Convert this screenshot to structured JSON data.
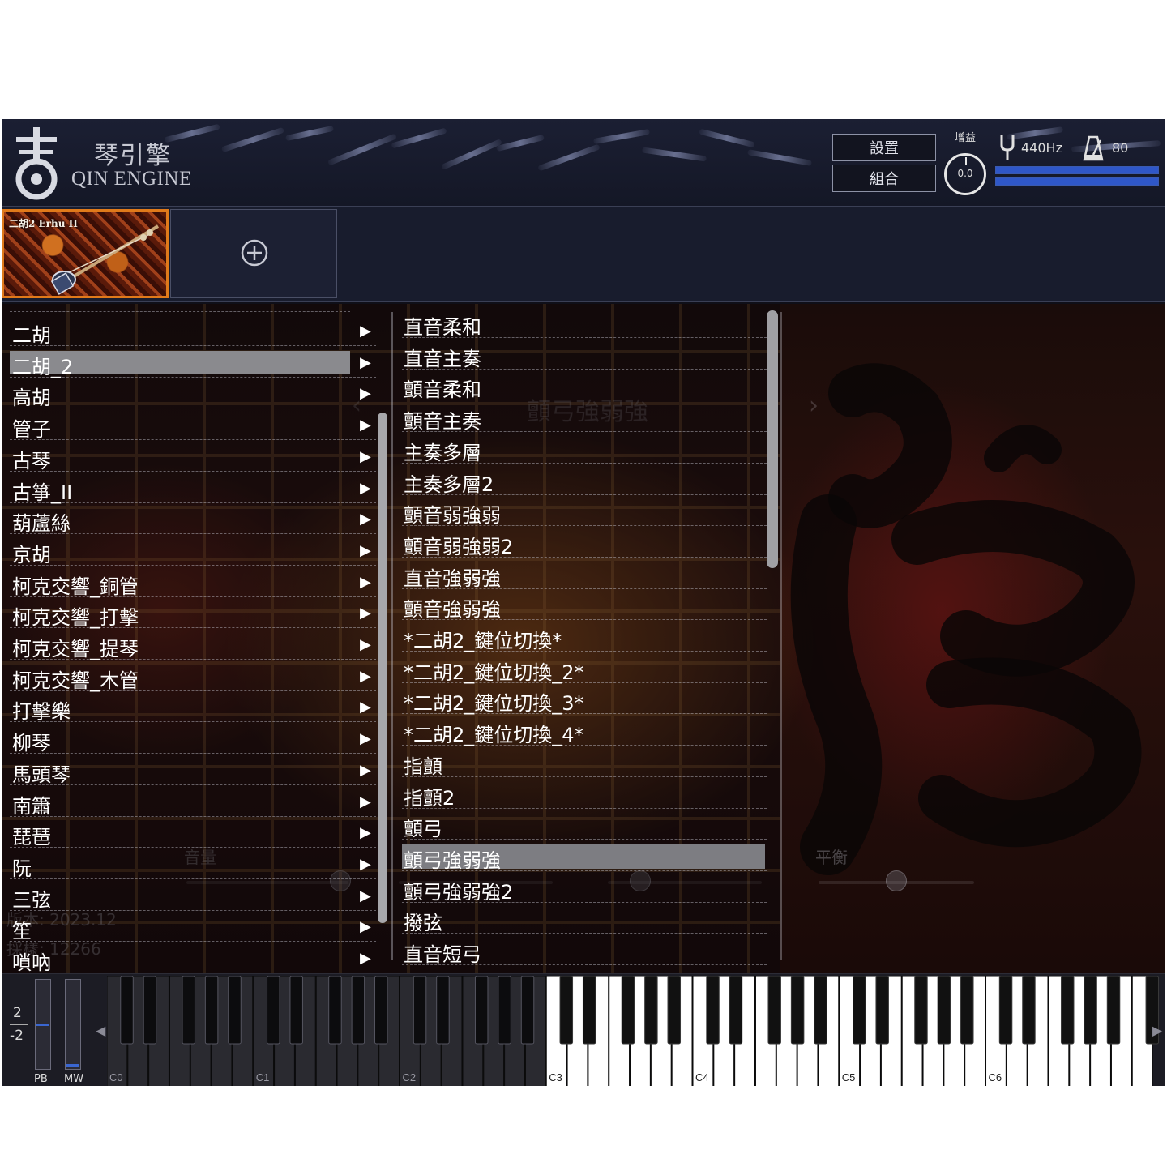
{
  "header": {
    "logo_cn": "琴引擎",
    "logo_en": "QIN ENGINE",
    "settings_label": "設置",
    "combine_label": "組合",
    "gain_label": "增益",
    "gain_value": "0.0",
    "tuning_value": "440Hz",
    "tempo_value": "80"
  },
  "slots": {
    "active_title": "二胡2 Erhu II"
  },
  "instruments": {
    "selected_index": 1,
    "items": [
      "二胡",
      "二胡_2",
      "高胡",
      "管子",
      "古琴",
      "古箏_II",
      "葫蘆絲",
      "京胡",
      "柯克交響_銅管",
      "柯克交響_打擊",
      "柯克交響_提琴",
      "柯克交響_木管",
      "打擊樂",
      "柳琴",
      "馬頭琴",
      "南簫",
      "琵琶",
      "阮",
      "三弦",
      "笙",
      "嗩吶"
    ]
  },
  "articulations": {
    "selected_index": 17,
    "items": [
      "直音柔和",
      "直音主奏",
      "顫音柔和",
      "顫音主奏",
      "主奏多層",
      "主奏多層2",
      "顫音弱強弱",
      "顫音弱強弱2",
      "直音強弱強",
      "顫音強弱強",
      "*二胡2_鍵位切換*",
      "*二胡2_鍵位切換_2*",
      "*二胡2_鍵位切換_3*",
      "*二胡2_鍵位切換_4*",
      "指顫",
      "指顫2",
      "顫弓",
      "顫弓強弱強",
      "顫弓強弱強2",
      "撥弦",
      "直音短弓"
    ]
  },
  "background": {
    "art_title": "顫弓強弱強",
    "volume_label": "音量",
    "pan_label": "平衡",
    "version_text": "版本: 2023.12",
    "samples_text": "採樣: 12266",
    "accent_color": "#e07a1a"
  },
  "keyboard": {
    "pb_range_up": "2",
    "pb_range_down": "-2",
    "pb_label": "PB",
    "mw_label": "MW",
    "octave_labels": [
      "C0",
      "C1",
      "C2",
      "C3",
      "C4",
      "C5",
      "C6"
    ],
    "first_octave": 0,
    "octave_count": 7,
    "playable_from_octave": 3
  }
}
